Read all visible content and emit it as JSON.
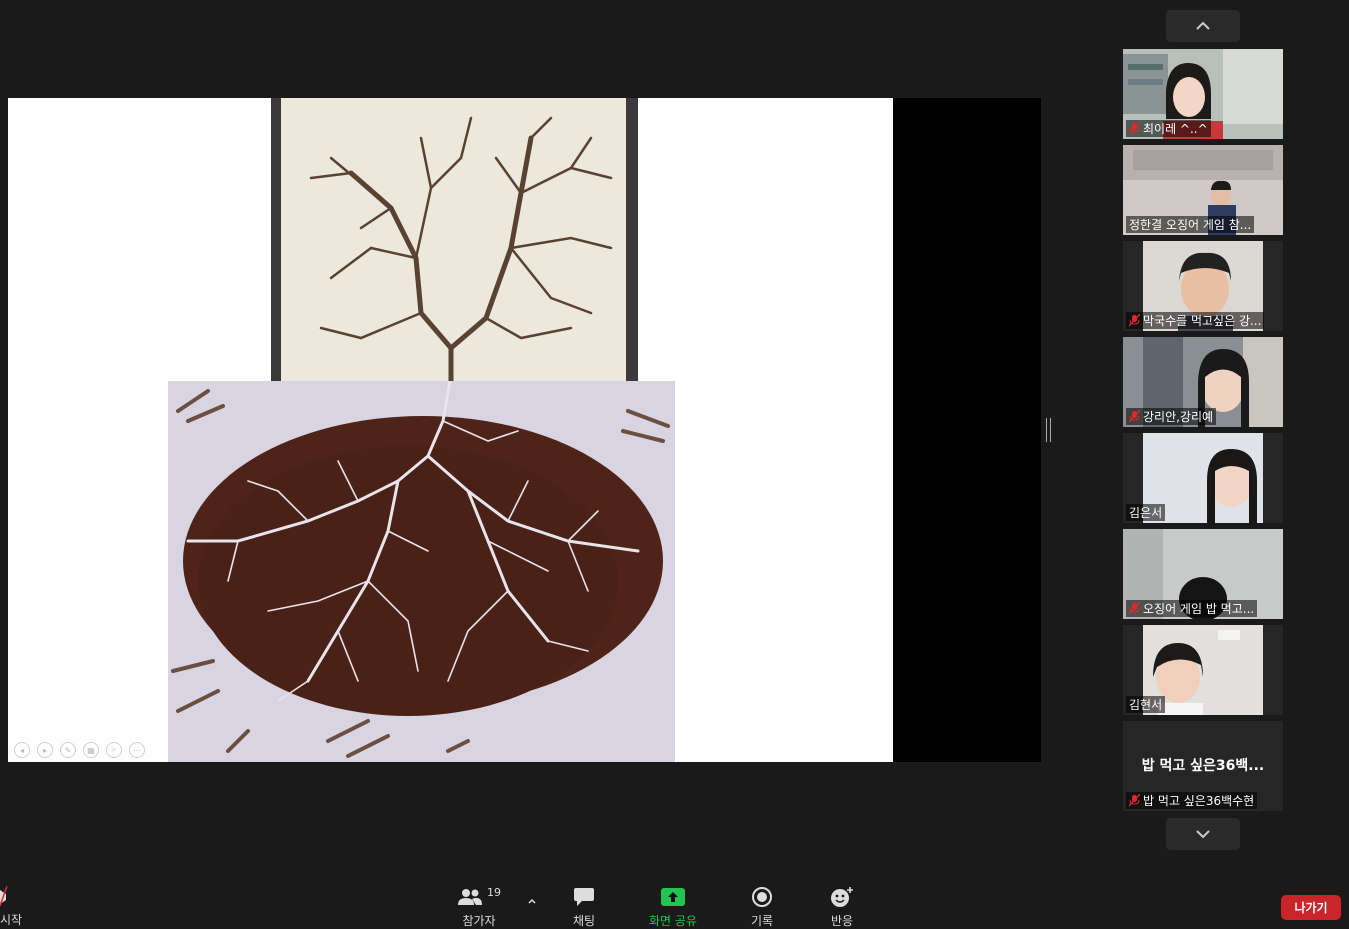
{
  "toolbar": {
    "left_label": "시작",
    "participants_label": "참가자",
    "participants_count": "19",
    "chat_label": "채팅",
    "share_label": "화면 공유",
    "record_label": "기록",
    "reactions_label": "반응",
    "leave_label": "나가기"
  },
  "participants": [
    {
      "name": "최이레 ^..^",
      "muted": true
    },
    {
      "name": "정한결  오징어 게임 참...",
      "muted": false
    },
    {
      "name": "막국수를 먹고싶은 강...",
      "muted": true
    },
    {
      "name": "강리안,강리예",
      "muted": true
    },
    {
      "name": "김은서",
      "muted": false
    },
    {
      "name": "오징어 게임   밥 먹고...",
      "muted": true
    },
    {
      "name": "김현서",
      "muted": false
    },
    {
      "name": "밥 먹고 싶은36백수현",
      "muted": true,
      "display_text": "밥 먹고 싶은36백..."
    }
  ],
  "colors": {
    "background": "#1a1a1a",
    "share_green": "#23c552",
    "leave_red": "#c9252b",
    "muted_red": "#e02828"
  }
}
